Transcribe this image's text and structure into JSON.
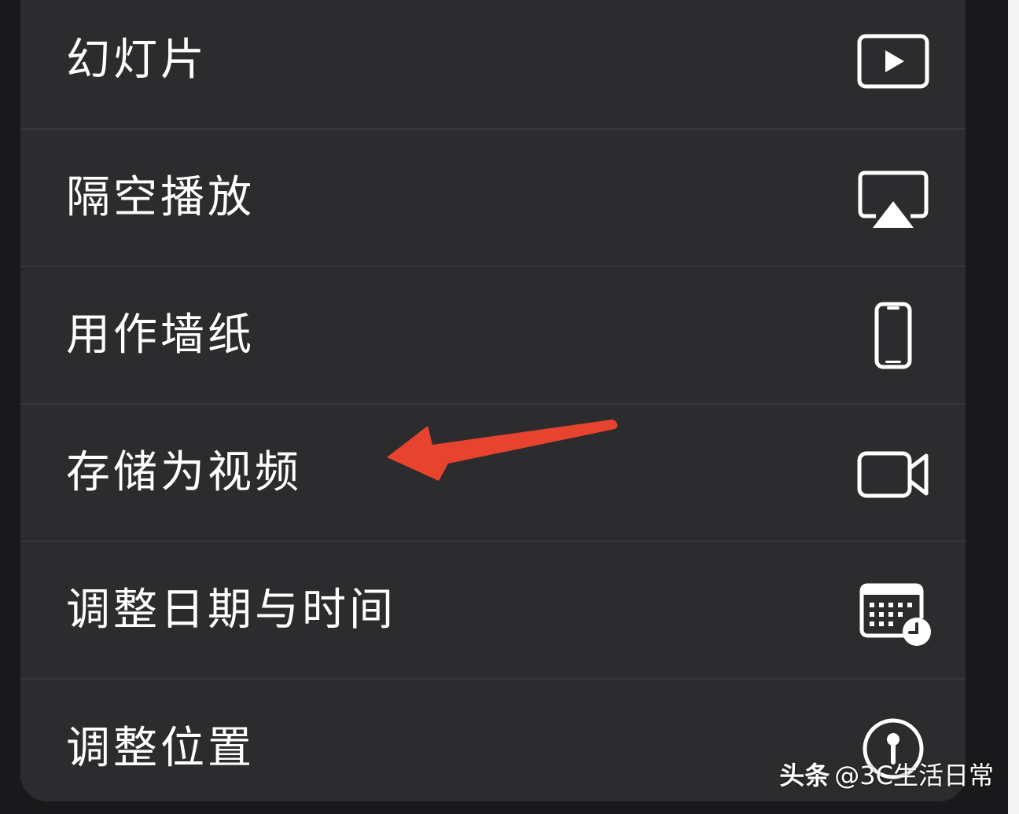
{
  "menu": {
    "items": [
      {
        "label": "幻灯片",
        "icon": "play-rectangle-icon"
      },
      {
        "label": "隔空播放",
        "icon": "airplay-icon"
      },
      {
        "label": "用作墙纸",
        "icon": "iphone-icon"
      },
      {
        "label": "存储为视频",
        "icon": "video-camera-icon"
      },
      {
        "label": "调整日期与时间",
        "icon": "calendar-clock-icon"
      },
      {
        "label": "调整位置",
        "icon": "location-pin-icon"
      }
    ]
  },
  "annotation": {
    "color": "#e8432e",
    "icon": "red-arrow-icon"
  },
  "watermark": {
    "brand": "头条",
    "handle": "@3C生活日常"
  },
  "colors": {
    "menu_background": "#2c2c2e",
    "separator": "#38383b",
    "text": "#ffffff"
  }
}
